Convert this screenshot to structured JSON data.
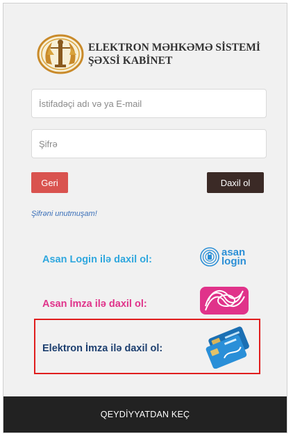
{
  "header": {
    "title_line1": "ELEKTRON MƏHKƏMƏ SİSTEMİ",
    "title_line2": "ŞƏXSİ KABİNET",
    "emblem_icon": "justice-scales-emblem-icon"
  },
  "form": {
    "username_placeholder": "İstifadəçi adı və ya E-mail",
    "password_placeholder": "Şifrə",
    "back_label": "Geri",
    "login_label": "Daxil ol",
    "forgot_label": "Şifrəni unutmuşam!"
  },
  "login_options": {
    "asan_login_label": "Asan Login ilə daxil ol:",
    "asan_logo_line1": "asan",
    "asan_logo_line2": "login",
    "asan_imza_label": "Asan İmza ilə daxil ol:",
    "electronic_signature_label": "Elektron İmza ilə daxil ol:"
  },
  "footer": {
    "register_label": "QEYDİYYATDAN KEÇ"
  },
  "colors": {
    "danger": "#d9534f",
    "dark_brown": "#3b2a26",
    "asan_blue": "#2fa7de",
    "imza_pink": "#e0338a",
    "electron_navy": "#1d3f6f",
    "highlight_red": "#e01d1d"
  }
}
